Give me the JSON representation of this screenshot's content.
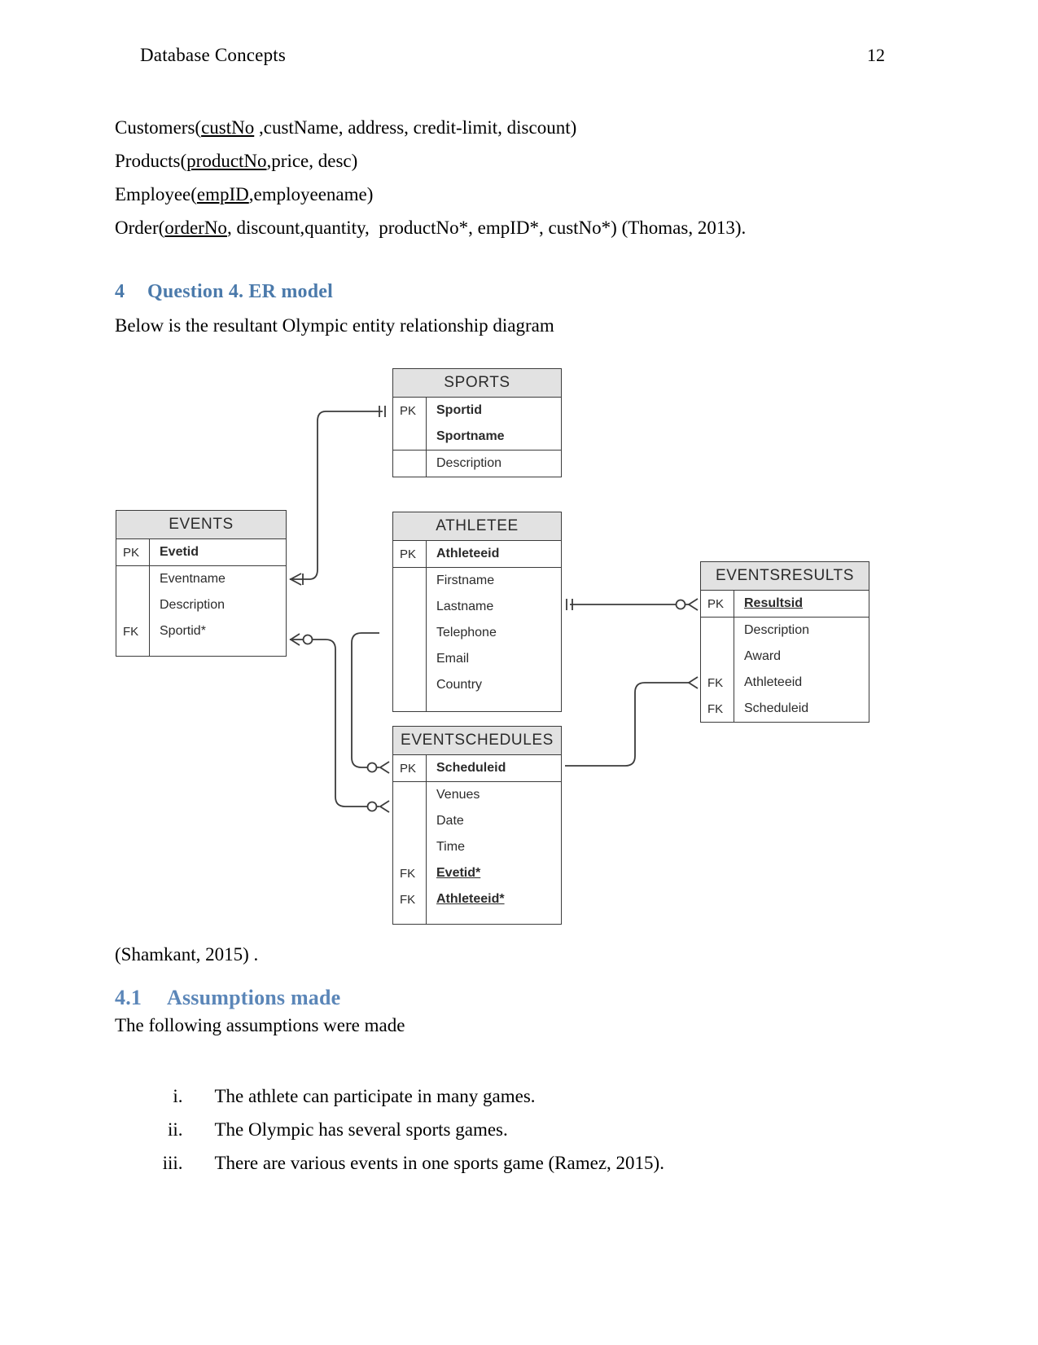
{
  "header": {
    "title": "Database Concepts",
    "page_number": "12"
  },
  "relations": [
    "Customers(custNo ,custName, address, credit-limit, discount)",
    "Products(productNo,price, desc)",
    "Employee(empID,employeename)",
    "Order(orderNo, discount,quantity,  productNo*, empID*, custNo*) (Thomas, 2013)."
  ],
  "relations_parts": {
    "r1_pre": "Customers(",
    "r1_u": "custNo",
    "r1_post": " ,custName, address, credit-limit, discount)",
    "r2_pre": "Products(",
    "r2_u": "productNo",
    "r2_post": ",price, desc)",
    "r3_pre": "Employee(",
    "r3_u": "empID",
    "r3_post": ",employeename)",
    "r4_pre": "Order(",
    "r4_u": "orderNo",
    "r4_post": ", discount,quantity,  productNo*, empID*, custNo*) (Thomas, 2013)."
  },
  "section4": {
    "number": "4",
    "title": "Question 4. ER model",
    "intro": "Below is the resultant Olympic entity relationship diagram",
    "citation": "(Shamkant, 2015) ."
  },
  "section41": {
    "number": "4.1",
    "title": "Assumptions made",
    "intro": "The following assumptions were made",
    "items": [
      {
        "marker": "i.",
        "text": "The athlete can participate in many games."
      },
      {
        "marker": "ii.",
        "text": "The Olympic has several sports games."
      },
      {
        "marker": "iii.",
        "text": "There are various events in one sports game (Ramez, 2015)."
      }
    ]
  },
  "er_diagram": {
    "colors": {
      "title_fill": "#e2e2e2",
      "border": "#3b3b3b",
      "text": "#2b2b2b",
      "line": "#3b3b3b"
    },
    "entities": [
      {
        "name": "SPORTS",
        "sections": [
          {
            "rows": [
              {
                "key": "PK",
                "attr": "Sportid",
                "style": "b"
              },
              {
                "key": "",
                "attr": "Sportname",
                "style": "b"
              }
            ]
          },
          {
            "rows": [
              {
                "key": "",
                "attr": "Description",
                "style": ""
              }
            ]
          }
        ]
      },
      {
        "name": "EVENTS",
        "sections": [
          {
            "rows": [
              {
                "key": "PK",
                "attr": "Evetid",
                "style": "b"
              }
            ]
          },
          {
            "rows": [
              {
                "key": "",
                "attr": "Eventname",
                "style": ""
              },
              {
                "key": "",
                "attr": "Description",
                "style": ""
              },
              {
                "key": "FK",
                "attr": "Sportid*",
                "style": ""
              }
            ]
          }
        ]
      },
      {
        "name": "ATHLETEE",
        "sections": [
          {
            "rows": [
              {
                "key": "PK",
                "attr": "Athleteeid",
                "style": "b"
              }
            ]
          },
          {
            "rows": [
              {
                "key": "",
                "attr": "Firstname",
                "style": ""
              },
              {
                "key": "",
                "attr": "Lastname",
                "style": ""
              },
              {
                "key": "",
                "attr": "Telephone",
                "style": ""
              },
              {
                "key": "",
                "attr": "Email",
                "style": ""
              },
              {
                "key": "",
                "attr": "Country",
                "style": ""
              }
            ]
          }
        ]
      },
      {
        "name": "EVENTSRESULTS",
        "sections": [
          {
            "rows": [
              {
                "key": "PK",
                "attr": "Resultsid",
                "style": "bu"
              }
            ]
          },
          {
            "rows": [
              {
                "key": "",
                "attr": "Description",
                "style": ""
              },
              {
                "key": "",
                "attr": "Award",
                "style": ""
              },
              {
                "key": "FK",
                "attr": "Athleteeid",
                "style": ""
              },
              {
                "key": "FK",
                "attr": "Scheduleid",
                "style": ""
              }
            ]
          }
        ]
      },
      {
        "name": "EVENTSCHEDULES",
        "sections": [
          {
            "rows": [
              {
                "key": "PK",
                "attr": "Scheduleid",
                "style": "b"
              }
            ]
          },
          {
            "rows": [
              {
                "key": "",
                "attr": "Venues",
                "style": ""
              },
              {
                "key": "",
                "attr": "Date",
                "style": ""
              },
              {
                "key": "",
                "attr": "Time",
                "style": ""
              },
              {
                "key": "FK",
                "attr": "Evetid*",
                "style": "bu"
              },
              {
                "key": "FK",
                "attr": "Athleteeid*",
                "style": "bu"
              }
            ]
          }
        ]
      }
    ],
    "relationships": [
      {
        "from": "SPORTS",
        "to": "EVENTS",
        "from_card": "one",
        "to_card": "many"
      },
      {
        "from": "EVENTS",
        "to": "EVENTSCHEDULES",
        "from_card": "many",
        "to_card": "zero-many"
      },
      {
        "from": "ATHLETEE",
        "to": "EVENTSRESULTS",
        "from_card": "one",
        "to_card": "zero-many"
      },
      {
        "from": "ATHLETEE",
        "to": "EVENTSCHEDULES",
        "from_card": "many",
        "to_card": "zero-many"
      },
      {
        "from": "EVENTSCHEDULES",
        "to": "EVENTSRESULTS",
        "from_card": "one",
        "to_card": "many"
      }
    ]
  }
}
